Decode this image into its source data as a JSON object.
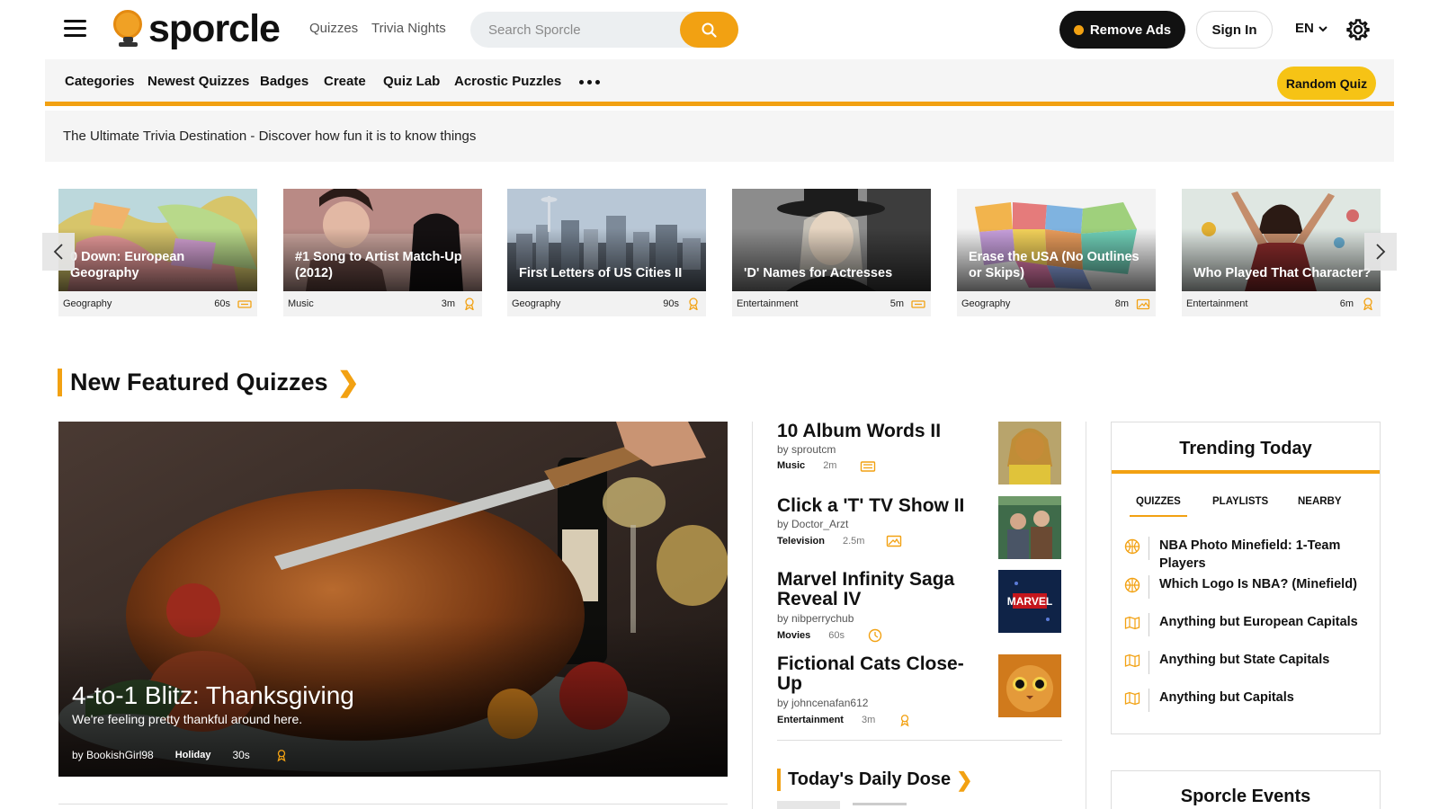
{
  "header": {
    "logo_text": "sporcle",
    "nav": [
      "Quizzes",
      "Trivia Nights"
    ],
    "search_placeholder": "Search Sporcle",
    "remove_ads": "Remove Ads",
    "sign_in": "Sign In",
    "language": "EN"
  },
  "navbar": {
    "items": [
      "Categories",
      "Newest Quizzes",
      "Badges",
      "Create",
      "Quiz Lab",
      "Acrostic Puzzles"
    ],
    "random_quiz": "Random Quiz"
  },
  "tagline": "The Ultimate Trivia Destination - Discover how fun it is to know things",
  "carousel": [
    {
      "title": "0 Down: European Geography",
      "category": "Geography",
      "time": "60s",
      "icon": "keyboard-icon"
    },
    {
      "title": "#1 Song to Artist Match-Up (2012)",
      "category": "Music",
      "time": "3m",
      "icon": "badge-icon"
    },
    {
      "title": "First Letters of US Cities II",
      "category": "Geography",
      "time": "90s",
      "icon": "badge-icon"
    },
    {
      "title": "'D' Names for Actresses",
      "category": "Entertainment",
      "time": "5m",
      "icon": "keyboard-icon"
    },
    {
      "title": "Erase the USA (No Outlines or Skips)",
      "category": "Geography",
      "time": "8m",
      "icon": "picture-icon"
    },
    {
      "title": "Who Played That Character?",
      "category": "Entertainment",
      "time": "6m",
      "icon": "badge-icon"
    }
  ],
  "featured": {
    "section_title": "New Featured Quizzes",
    "hero": {
      "title": "4-to-1 Blitz: Thanksgiving",
      "subtitle": "We're feeling pretty thankful around here.",
      "author": "by BookishGirl98",
      "category": "Holiday",
      "time": "30s"
    },
    "list": [
      {
        "title": "10 Album Words II",
        "author": "by sproutcm",
        "category": "Music",
        "time": "2m"
      },
      {
        "title": "Click a 'T' TV Show II",
        "author": "by Doctor_Arzt",
        "category": "Television",
        "time": "2.5m"
      },
      {
        "title": "Marvel Infinity Saga Reveal IV",
        "author": "by nibperrychub",
        "category": "Movies",
        "time": "60s"
      },
      {
        "title": "Fictional Cats Close-Up",
        "author": "by johncenafan612",
        "category": "Entertainment",
        "time": "3m"
      }
    ],
    "daily_title": "Today's Daily Dose",
    "marvel_logo": "MARVEL"
  },
  "trending": {
    "title": "Trending Today",
    "tabs": [
      "QUIZZES",
      "PLAYLISTS",
      "NEARBY"
    ],
    "items": [
      {
        "title": "NBA Photo Minefield: 1-Team Players",
        "icon": "basketball-icon"
      },
      {
        "title": "Which Logo Is NBA? (Minefield)",
        "icon": "basketball-icon"
      },
      {
        "title": "Anything but European Capitals",
        "icon": "map-icon"
      },
      {
        "title": "Anything but State Capitals",
        "icon": "map-icon"
      },
      {
        "title": "Anything but Capitals",
        "icon": "map-icon"
      }
    ]
  },
  "events": {
    "title": "Sporcle Events"
  },
  "colors": {
    "accent": "#f2a112",
    "random_btn": "#f6c315",
    "dark": "#111111"
  }
}
